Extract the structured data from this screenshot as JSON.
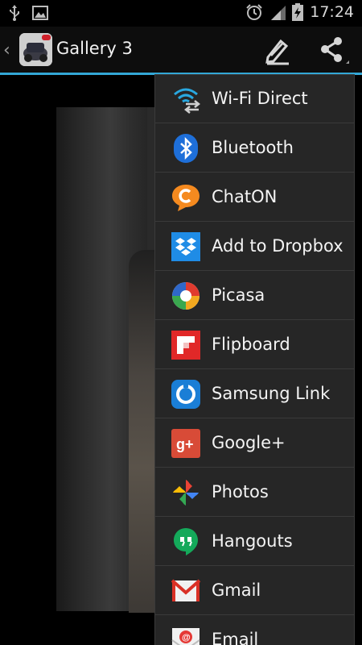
{
  "status_bar": {
    "time": "17:24"
  },
  "action_bar": {
    "back": "‹",
    "title": "Gallery 3"
  },
  "share_menu": {
    "items": [
      {
        "label": "Wi-Fi Direct",
        "icon": "wifi-direct-icon"
      },
      {
        "label": "Bluetooth",
        "icon": "bluetooth-icon"
      },
      {
        "label": "ChatON",
        "icon": "chaton-icon"
      },
      {
        "label": "Add to Dropbox",
        "icon": "dropbox-icon"
      },
      {
        "label": "Picasa",
        "icon": "picasa-icon"
      },
      {
        "label": "Flipboard",
        "icon": "flipboard-icon"
      },
      {
        "label": "Samsung Link",
        "icon": "samsung-link-icon"
      },
      {
        "label": "Google+",
        "icon": "google-plus-icon"
      },
      {
        "label": "Photos",
        "icon": "photos-icon"
      },
      {
        "label": "Hangouts",
        "icon": "hangouts-icon"
      },
      {
        "label": "Gmail",
        "icon": "gmail-icon"
      },
      {
        "label": "Email",
        "icon": "email-icon"
      }
    ]
  },
  "colors": {
    "accent": "#33a7d6",
    "menu_bg": "#262626"
  }
}
